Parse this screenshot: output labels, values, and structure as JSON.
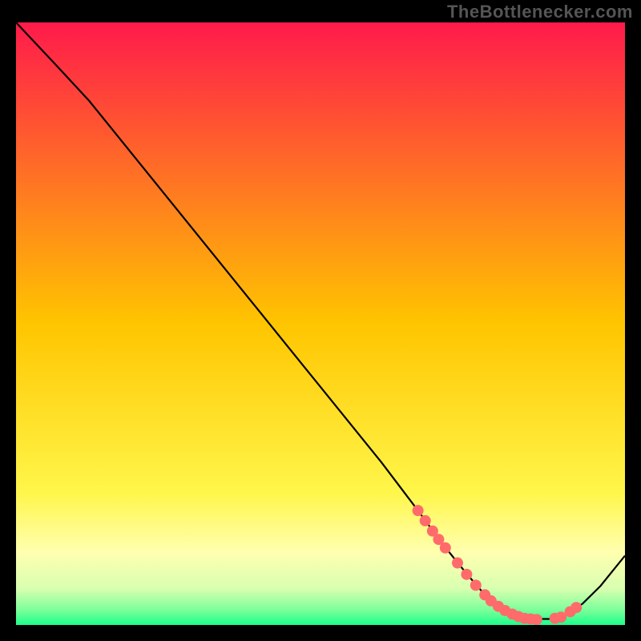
{
  "watermark": "TheBottlenecker.com",
  "chart_data": {
    "type": "line",
    "title": "",
    "xlabel": "",
    "ylabel": "",
    "xlim": [
      0,
      100
    ],
    "ylim": [
      0,
      100
    ],
    "background_gradient": {
      "stops": [
        {
          "offset": 0.0,
          "color": "#ff1a4b"
        },
        {
          "offset": 0.5,
          "color": "#ffc500"
        },
        {
          "offset": 0.78,
          "color": "#fff64a"
        },
        {
          "offset": 0.88,
          "color": "#ffffb0"
        },
        {
          "offset": 0.94,
          "color": "#d8ffb0"
        },
        {
          "offset": 0.975,
          "color": "#7cff9a"
        },
        {
          "offset": 1.0,
          "color": "#1cff8a"
        }
      ]
    },
    "series": [
      {
        "name": "bottleneck-curve",
        "color": "#000000",
        "x": [
          0.0,
          6.5,
          12.0,
          20.0,
          30.0,
          40.0,
          50.0,
          60.0,
          66.0,
          70.0,
          72.0,
          74.0,
          77.0,
          80.0,
          83.0,
          86.0,
          88.0,
          90.0,
          93.0,
          96.0,
          100.0
        ],
        "y": [
          100.0,
          93.0,
          87.0,
          77.0,
          64.5,
          52.0,
          39.5,
          27.0,
          19.0,
          13.5,
          11.0,
          8.5,
          5.0,
          2.5,
          1.2,
          1.0,
          1.0,
          1.5,
          3.5,
          6.5,
          11.5
        ]
      }
    ],
    "markers": {
      "name": "highlight-points",
      "color": "#ff6b6b",
      "radius": 7,
      "x": [
        66.0,
        67.2,
        68.4,
        69.4,
        70.5,
        72.5,
        74.0,
        75.5,
        77.0,
        78.0,
        79.2,
        80.3,
        81.5,
        82.5,
        83.5,
        84.5,
        85.5,
        88.5,
        89.5,
        91.0,
        92.0
      ],
      "y": [
        19.0,
        17.3,
        15.6,
        14.2,
        12.8,
        10.3,
        8.4,
        6.6,
        5.0,
        4.0,
        3.1,
        2.4,
        1.8,
        1.4,
        1.1,
        1.0,
        0.9,
        1.1,
        1.3,
        2.2,
        2.9
      ]
    }
  }
}
